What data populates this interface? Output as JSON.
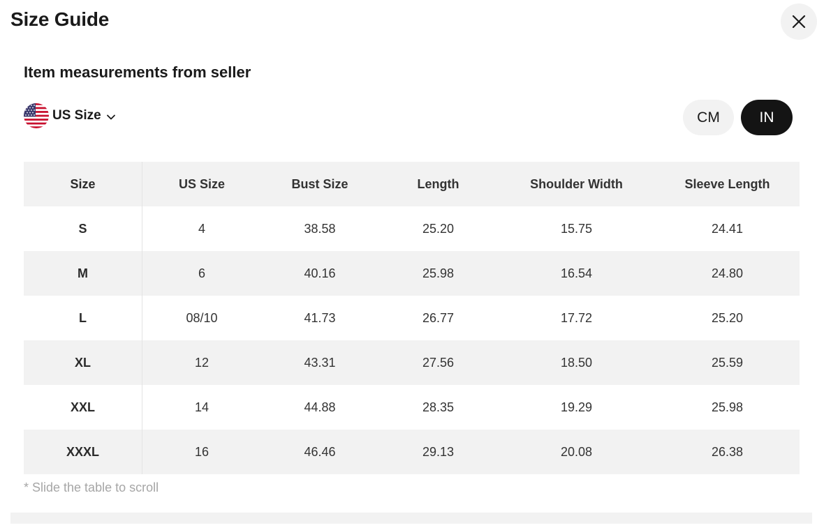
{
  "header": {
    "title": "Size Guide",
    "close_icon": "close-icon"
  },
  "section": {
    "subtitle": "Item measurements from seller"
  },
  "region": {
    "flag_icon": "us-flag-icon",
    "label": "US Size",
    "chevron_icon": "chevron-down-icon"
  },
  "units": {
    "options": [
      "CM",
      "IN"
    ],
    "selected": "IN"
  },
  "colors": {
    "selected_unit_bg": "#141414",
    "unselected_unit_bg": "#f2f2f2",
    "row_shade": "#f2f2f2"
  },
  "table": {
    "columns": [
      "Size",
      "US Size",
      "Bust Size",
      "Length",
      "Shoulder Width",
      "Sleeve Length"
    ],
    "rows": [
      [
        "S",
        "4",
        "38.58",
        "25.20",
        "15.75",
        "24.41"
      ],
      [
        "M",
        "6",
        "40.16",
        "25.98",
        "16.54",
        "24.80"
      ],
      [
        "L",
        "08/10",
        "41.73",
        "26.77",
        "17.72",
        "25.20"
      ],
      [
        "XL",
        "12",
        "43.31",
        "27.56",
        "18.50",
        "25.59"
      ],
      [
        "XXL",
        "14",
        "44.88",
        "28.35",
        "19.29",
        "25.98"
      ],
      [
        "XXXL",
        "16",
        "46.46",
        "29.13",
        "20.08",
        "26.38"
      ]
    ]
  },
  "note": "* Slide the table to scroll"
}
